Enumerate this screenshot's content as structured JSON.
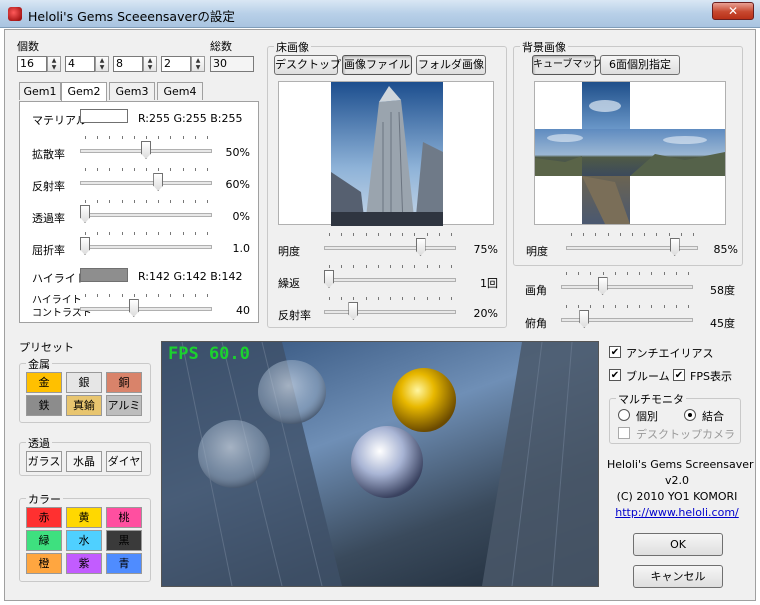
{
  "window": {
    "title": "Heloli's Gems Sceeensaverの設定",
    "close": "✕"
  },
  "counts": {
    "label": "個数",
    "total_label": "総数",
    "values": [
      "16",
      "4",
      "8",
      "2"
    ],
    "total": "30"
  },
  "gem_tabs": [
    "Gem1",
    "Gem2",
    "Gem3",
    "Gem4"
  ],
  "gem": {
    "material_label": "マテリアル",
    "material_rgb": "R:255 G:255 B:255",
    "material_color": "#ffffff",
    "highlight_label": "ハイライト",
    "highlight_rgb": "R:142 G:142 B:142",
    "highlight_color": "#8e8e8e",
    "sliders": [
      {
        "label": "拡散率",
        "value": "50%",
        "pos": 0.5
      },
      {
        "label": "反射率",
        "value": "60%",
        "pos": 0.6
      },
      {
        "label": "透過率",
        "value": "0%",
        "pos": 0.0
      },
      {
        "label": "屈折率",
        "value": "1.0",
        "pos": 0.0
      }
    ],
    "hl_contrast_label": [
      "ハイライト",
      "コントラスト"
    ],
    "hl_contrast_value": "40",
    "hl_contrast_pos": 0.4
  },
  "floor": {
    "group": "床画像",
    "buttons": [
      "デスクトップ",
      "画像ファイル",
      "フォルダ画像"
    ],
    "selected": 1,
    "sliders": [
      {
        "label": "明度",
        "value": "75%",
        "pos": 0.75
      },
      {
        "label": "繰返",
        "value": "1回",
        "pos": 0.0
      },
      {
        "label": "反射率",
        "value": "20%",
        "pos": 0.2
      }
    ]
  },
  "bg": {
    "group": "背景画像",
    "buttons": [
      "キューブマップ",
      "6面個別指定"
    ],
    "selected": 0,
    "brightness_label": "明度",
    "brightness_value": "85%",
    "brightness_pos": 0.85
  },
  "view": {
    "fov_label": "画角",
    "fov_value": "58度",
    "fov_pos": 0.3,
    "tilt_label": "俯角",
    "tilt_value": "45度",
    "tilt_pos": 0.15
  },
  "preset": {
    "label": "プリセット",
    "metal": {
      "label": "金属",
      "items": [
        {
          "label": "金",
          "color": "#ffc000"
        },
        {
          "label": "銀",
          "color": "#e6e6e6"
        },
        {
          "label": "銅",
          "color": "#d9836a"
        },
        {
          "label": "鉄",
          "color": "#8c8c8c"
        },
        {
          "label": "真鍮",
          "color": "#e8c56f"
        },
        {
          "label": "アルミ",
          "color": "#bdbdbd"
        }
      ]
    },
    "clear": {
      "label": "透過",
      "items": [
        {
          "label": "ガラス",
          "color": "#f4f4f4"
        },
        {
          "label": "水晶",
          "color": "#f4f4f4"
        },
        {
          "label": "ダイヤ",
          "color": "#f4f4f4"
        }
      ]
    },
    "color": {
      "label": "カラー",
      "items": [
        {
          "label": "赤",
          "color": "#ff3030"
        },
        {
          "label": "黄",
          "color": "#ffd800"
        },
        {
          "label": "桃",
          "color": "#ff4fa0"
        },
        {
          "label": "緑",
          "color": "#3ee07f"
        },
        {
          "label": "水",
          "color": "#4fd0ff"
        },
        {
          "label": "黒",
          "color": "#3a3a3a"
        },
        {
          "label": "橙",
          "color": "#ffa640"
        },
        {
          "label": "紫",
          "color": "#c25cff"
        },
        {
          "label": "青",
          "color": "#4f8cff"
        }
      ]
    }
  },
  "preview": {
    "fps": "FPS 60.0"
  },
  "options": {
    "antialias": "アンチエイリアス",
    "bloom": "ブルーム",
    "fps_show": "FPS表示"
  },
  "multi": {
    "group": "マルチモニタ",
    "individual": "個別",
    "join": "結合",
    "desktop_camera": "デスクトップカメラ"
  },
  "about": {
    "name": "Heloli's Gems Screensaver",
    "version": "v2.0",
    "copyright": "(C) 2010 YO1 KOMORI",
    "url": "http://www.heloli.com/"
  },
  "buttons": {
    "ok": "OK",
    "cancel": "キャンセル"
  }
}
